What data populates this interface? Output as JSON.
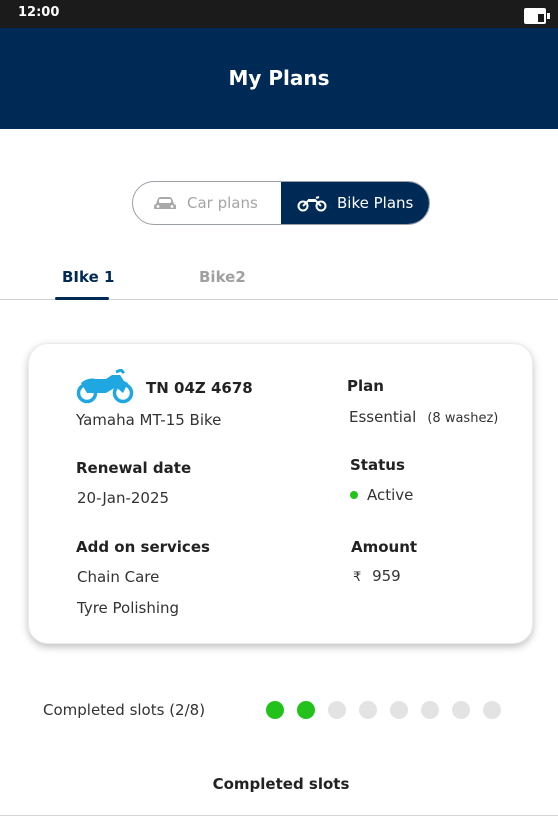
{
  "status_bar": {
    "time": "12:00"
  },
  "header": {
    "title": "My Plans"
  },
  "toggle": {
    "car_label": "Car plans",
    "bike_label": "Bike Plans"
  },
  "tabs": [
    {
      "label": "BIke 1"
    },
    {
      "label": "Bike2"
    }
  ],
  "vehicle": {
    "number": "TN 04Z 4678",
    "model": "Yamaha MT-15 Bike",
    "renewal_label": "Renewal date",
    "renewal_date": "20-Jan-2025",
    "addons_label": "Add on services",
    "addons": [
      "Chain Care",
      "Tyre Polishing"
    ],
    "plan_label": "Plan",
    "plan_name": "Essential",
    "plan_detail": "(8 washez)",
    "status_label": "Status",
    "status_value": "Active",
    "amount_label": "Amount",
    "currency": "₹",
    "amount": "959"
  },
  "slots": {
    "label": "Completed slots (2/8)",
    "completed": 2,
    "total": 8,
    "section_title": "Completed slots"
  },
  "colors": {
    "primary": "#002a56",
    "accent_bike_icon": "#1ea7e1",
    "active_green": "#22c21a",
    "inactive_dot": "#e3e3e3"
  }
}
